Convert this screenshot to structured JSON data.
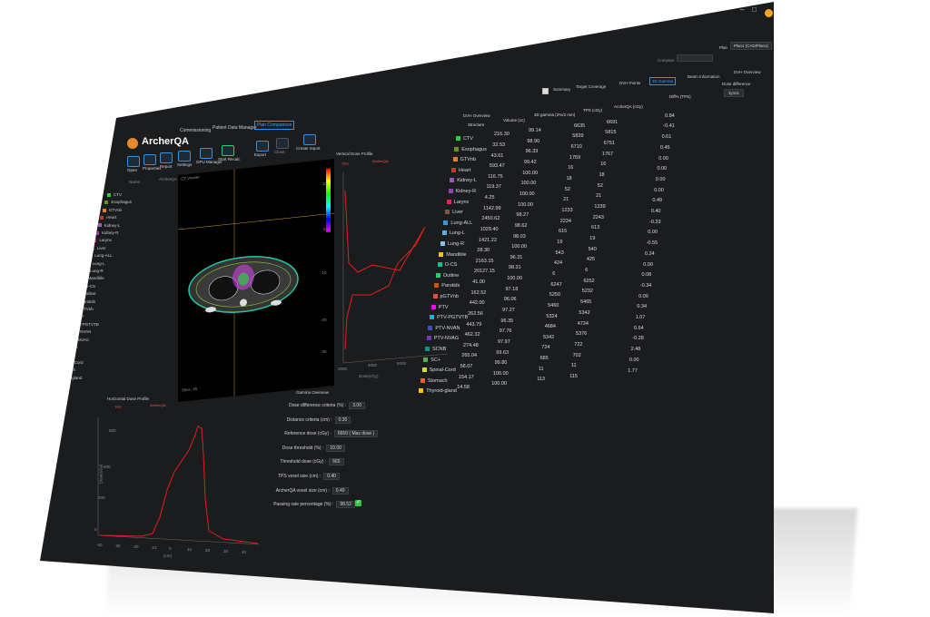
{
  "app": {
    "title": "ArcherQA"
  },
  "menu": [
    "Commissioning",
    "Patient Data Manager",
    "Plan Comparison"
  ],
  "toolbar": [
    {
      "label": "Open"
    },
    {
      "label": "Properties"
    },
    {
      "label": "Report"
    },
    {
      "label": "Settings"
    },
    {
      "label": "GPU Manager"
    },
    {
      "label": "Start Recalc"
    },
    {
      "label": "Export"
    },
    {
      "label": "Close"
    },
    {
      "label": "Create report"
    }
  ],
  "patient_panel": {
    "header": "Name",
    "col2": "ArcherQA",
    "col3": "TPS Name"
  },
  "structures_tree": [
    {
      "name": "CTV",
      "color": "#2ecc40"
    },
    {
      "name": "Esophagus",
      "color": "#6b8e23"
    },
    {
      "name": "GTVnb",
      "color": "#e67e22"
    },
    {
      "name": "Heart",
      "color": "#c0392b"
    },
    {
      "name": "Kidney-L",
      "color": "#9b59b6"
    },
    {
      "name": "Kidney-R",
      "color": "#8e44ad"
    },
    {
      "name": "Larynx",
      "color": "#e91e63"
    },
    {
      "name": "Liver",
      "color": "#795548"
    },
    {
      "name": "Lung-ALL",
      "color": "#3498db"
    },
    {
      "name": "Lung-L",
      "color": "#5dade2"
    },
    {
      "name": "Lung-R",
      "color": "#85c1e9"
    },
    {
      "name": "Mandible",
      "color": "#f1c40f"
    },
    {
      "name": "O-CS",
      "color": "#1abc9c"
    },
    {
      "name": "Outline",
      "color": "#2ecc71"
    },
    {
      "name": "Parotids",
      "color": "#d35400"
    },
    {
      "name": "pGTVnb",
      "color": "#e74c3c"
    },
    {
      "name": "PTV",
      "color": "#ff00ff"
    },
    {
      "name": "PTV-PGTVTB",
      "color": "#00bcd4"
    },
    {
      "name": "PTV-NVAN",
      "color": "#3f51b5"
    },
    {
      "name": "PTV-NVAG",
      "color": "#673ab7"
    },
    {
      "name": "SCNB",
      "color": "#009688"
    },
    {
      "name": "SC+",
      "color": "#4caf50"
    },
    {
      "name": "Spinal-Cord",
      "color": "#cddc39"
    },
    {
      "name": "Stomach",
      "color": "#ff5722"
    },
    {
      "name": "Thyroid-gland",
      "color": "#ffc107"
    }
  ],
  "ct_view": {
    "title": "CT Viewer",
    "overlay_text": "Slice: 45"
  },
  "vertical_profile": {
    "title": "Vertical Dose Profile",
    "legend": [
      "TPS",
      "ArcherQA"
    ],
    "y_ticks": [
      "10",
      "0",
      "-10",
      "-20",
      "-30"
    ],
    "x_ticks": [
      "2000",
      "4000",
      "6000"
    ],
    "xlabel": "Dose(cGy)"
  },
  "horizontal_profile": {
    "title": "Horizontal Dose Profile",
    "legend": [
      "TPS",
      "ArcherQA"
    ],
    "y_ticks": [
      "600",
      "400",
      "200",
      "0"
    ],
    "x_ticks": [
      "-40",
      "-30",
      "-20",
      "-10",
      "0",
      "10",
      "20",
      "30",
      "40"
    ],
    "ylabel": "Dose(cGy)",
    "xlabel": "(cm)"
  },
  "gamma_summary": {
    "title": "Gamma Overview",
    "rows": [
      {
        "label": "Dose difference criteria (%) :",
        "value": "3.00"
      },
      {
        "label": "Distance criteria (cm) :",
        "value": "0.30"
      },
      {
        "label": "Reference dose (cGy) :",
        "value": "6650 ( Max dose )"
      },
      {
        "label": "Dose threshold (%) :",
        "value": "10.00"
      },
      {
        "label": "Threshold dose (cGy) :",
        "value": "665"
      },
      {
        "label": "TPS voxel size (cm) :",
        "value": "0.40"
      },
      {
        "label": "ArcherQA voxel size (cm) :",
        "value": "0.40"
      },
      {
        "label": "Passing rate percentage (%) :",
        "value": "98.52"
      }
    ]
  },
  "top_bar": {
    "checkbox_label": "Summary",
    "tabs": [
      "Target Coverage",
      "DVH Points",
      "3D Gamma",
      "Beam Information",
      "DVH Overview"
    ],
    "active_tab": "3D Gamma",
    "plan_label": "Plan",
    "plan_value": "Plan1 (CAD/Plan1)",
    "combo_label": "Compare",
    "right_label": "Dose difference",
    "right_value": "3y1s1"
  },
  "dvh_table": {
    "title": "DVH Overview",
    "headers": [
      "Structure",
      "Volume (cc)",
      "3D gamma (2%/2 mm)",
      "TPS (cGy)",
      "ArcherQA (cGy)",
      "Diff% (TPS)"
    ],
    "rows": [
      {
        "name": "CTV",
        "color": "#2ecc40",
        "vol": "216.30",
        "gamma": "99.14",
        "tps": "6635",
        "aq": "6691",
        "diff": "0.84"
      },
      {
        "name": "Esophagus",
        "color": "#6b8e23",
        "vol": "32.53",
        "gamma": "98.90",
        "tps": "5839",
        "aq": "5815",
        "diff": "-0.41"
      },
      {
        "name": "GTVnb",
        "color": "#e67e22",
        "vol": "43.61",
        "gamma": "96.33",
        "tps": "6710",
        "aq": "6751",
        "diff": "0.61"
      },
      {
        "name": "Heart",
        "color": "#c0392b",
        "vol": "593.47",
        "gamma": "99.42",
        "tps": "1759",
        "aq": "1767",
        "diff": "0.45"
      },
      {
        "name": "Kidney-L",
        "color": "#9b59b6",
        "vol": "116.75",
        "gamma": "100.00",
        "tps": "16",
        "aq": "16",
        "diff": "0.00"
      },
      {
        "name": "Kidney-R",
        "color": "#8e44ad",
        "vol": "119.37",
        "gamma": "100.00",
        "tps": "18",
        "aq": "18",
        "diff": "0.00"
      },
      {
        "name": "Larynx",
        "color": "#e91e63",
        "vol": "4.25",
        "gamma": "100.00",
        "tps": "52",
        "aq": "52",
        "diff": "0.00"
      },
      {
        "name": "Liver",
        "color": "#795548",
        "vol": "1142.99",
        "gamma": "100.00",
        "tps": "21",
        "aq": "21",
        "diff": "0.00"
      },
      {
        "name": "Lung-ALL",
        "color": "#3498db",
        "vol": "2450.62",
        "gamma": "98.27",
        "tps": "1233",
        "aq": "1239",
        "diff": "0.49"
      },
      {
        "name": "Lung-L",
        "color": "#5dade2",
        "vol": "1029.40",
        "gamma": "98.62",
        "tps": "2234",
        "aq": "2243",
        "diff": "0.40"
      },
      {
        "name": "Lung-R",
        "color": "#85c1e9",
        "vol": "1421.22",
        "gamma": "98.03",
        "tps": "615",
        "aq": "613",
        "diff": "-0.33"
      },
      {
        "name": "Mandible",
        "color": "#f1c40f",
        "vol": "28.30",
        "gamma": "100.00",
        "tps": "19",
        "aq": "19",
        "diff": "0.00"
      },
      {
        "name": "O-CS",
        "color": "#1abc9c",
        "vol": "2163.15",
        "gamma": "96.31",
        "tps": "543",
        "aq": "540",
        "diff": "-0.55"
      },
      {
        "name": "Outline",
        "color": "#2ecc71",
        "vol": "20127.15",
        "gamma": "98.31",
        "tps": "424",
        "aq": "425",
        "diff": "0.24"
      },
      {
        "name": "Parotids",
        "color": "#d35400",
        "vol": "41.00",
        "gamma": "100.00",
        "tps": "6",
        "aq": "6",
        "diff": "0.00"
      },
      {
        "name": "pGTVnb",
        "color": "#e74c3c",
        "vol": "162.52",
        "gamma": "97.18",
        "tps": "6247",
        "aq": "6252",
        "diff": "0.08"
      },
      {
        "name": "PTV",
        "color": "#ff00ff",
        "vol": "442.00",
        "gamma": "96.06",
        "tps": "5250",
        "aq": "5232",
        "diff": "-0.34"
      },
      {
        "name": "PTV-PGTVTB",
        "color": "#00bcd4",
        "vol": "262.56",
        "gamma": "97.27",
        "tps": "5460",
        "aq": "5465",
        "diff": "0.09"
      },
      {
        "name": "PTV-NVAN",
        "color": "#3f51b5",
        "vol": "443.79",
        "gamma": "96.35",
        "tps": "5324",
        "aq": "5342",
        "diff": "0.34"
      },
      {
        "name": "PTV-NVAG",
        "color": "#673ab7",
        "vol": "462.32",
        "gamma": "97.76",
        "tps": "4684",
        "aq": "4734",
        "diff": "1.07"
      },
      {
        "name": "SCNB",
        "color": "#009688",
        "vol": "274.48",
        "gamma": "97.97",
        "tps": "5342",
        "aq": "5376",
        "diff": "0.64"
      },
      {
        "name": "SC+",
        "color": "#4caf50",
        "vol": "265.04",
        "gamma": "99.63",
        "tps": "724",
        "aq": "722",
        "diff": "-0.28"
      },
      {
        "name": "Spinal-Cord",
        "color": "#cddc39",
        "vol": "58.07",
        "gamma": "99.80",
        "tps": "685",
        "aq": "702",
        "diff": "2.48"
      },
      {
        "name": "Stomach",
        "color": "#ff5722",
        "vol": "154.17",
        "gamma": "100.00",
        "tps": "11",
        "aq": "11",
        "diff": "0.00"
      },
      {
        "name": "Thyroid-gland",
        "color": "#ffc107",
        "vol": "14.58",
        "gamma": "100.00",
        "tps": "113",
        "aq": "115",
        "diff": "1.77"
      }
    ]
  }
}
